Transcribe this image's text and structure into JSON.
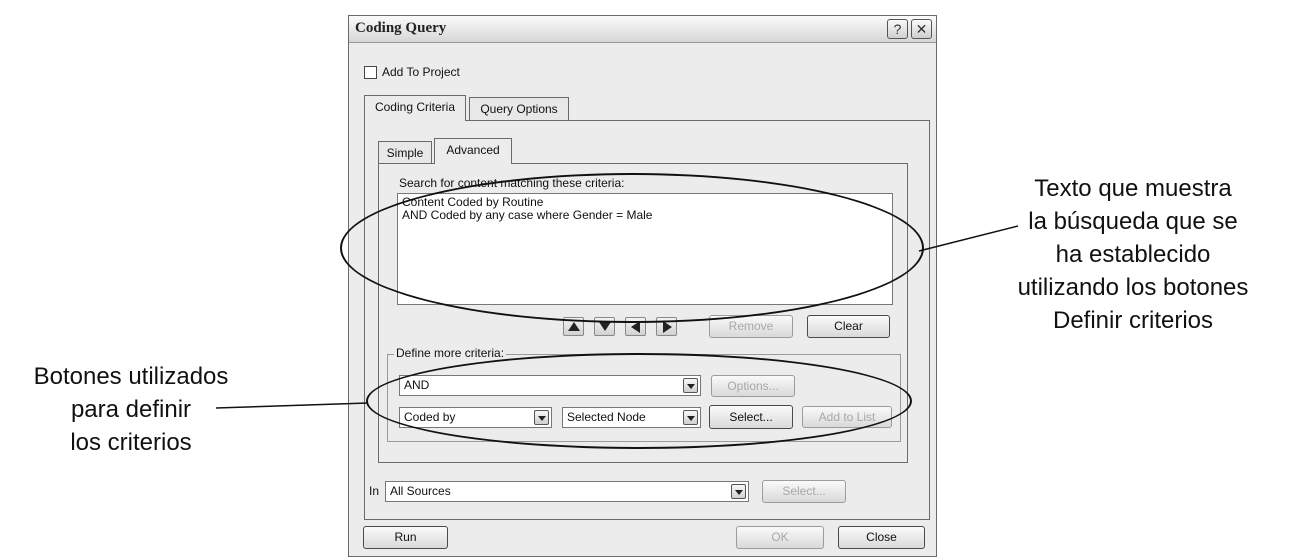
{
  "dialog": {
    "title": "Coding Query",
    "help_glyph": "?",
    "close_glyph": "✕",
    "add_to_project": "Add To Project",
    "tabs": [
      "Coding Criteria",
      "Query Options"
    ],
    "subtabs": [
      "Simple",
      "Advanced"
    ],
    "search_label": "Search for content matching these criteria:",
    "criteria_text": "Content Coded by Routine\nAND Coded by any case where Gender = Male",
    "remove": "Remove",
    "clear": "Clear",
    "define_more": "Define more criteria:",
    "operator": "AND",
    "options": "Options...",
    "field": "Coded by",
    "node": "Selected Node",
    "select": "Select...",
    "add_to_list": "Add to List",
    "in_label": "In",
    "in_value": "All Sources",
    "in_select": "Select...",
    "run": "Run",
    "ok": "OK",
    "close": "Close"
  },
  "annotations": {
    "right": "Texto que muestra\nla búsqueda que se\nha establecido\nutilizando los botones\nDefinir criterios",
    "left": "Botones utilizados\npara definir\nlos criterios"
  },
  "icons": {
    "checkbox": "checkbox-unchecked-icon",
    "move_up": "arrow-up-icon",
    "move_down": "arrow-down-icon",
    "move_left": "arrow-left-icon",
    "move_right": "arrow-right-icon",
    "dropdown": "chevron-down-icon"
  }
}
